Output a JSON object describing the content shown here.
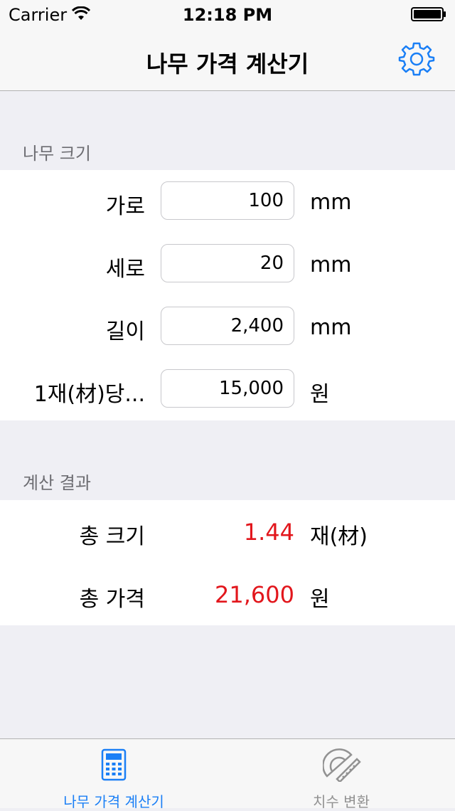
{
  "status": {
    "carrier": "Carrier",
    "time": "12:18 PM"
  },
  "nav": {
    "title": "나무 가격 계산기",
    "settings_icon": "gear-icon"
  },
  "size_section": {
    "header": "나무 크기",
    "rows": [
      {
        "label": "가로",
        "value": "100",
        "unit": "mm"
      },
      {
        "label": "세로",
        "value": "20",
        "unit": "mm"
      },
      {
        "label": "길이",
        "value": "2,400",
        "unit": "mm"
      },
      {
        "label": "1재(材)당...",
        "value": "15,000",
        "unit": "원"
      }
    ]
  },
  "result_section": {
    "header": "계산 결과",
    "rows": [
      {
        "label": "총 크기",
        "value": "1.44",
        "unit": "재(材)"
      },
      {
        "label": "총 가격",
        "value": "21,600",
        "unit": "원"
      }
    ]
  },
  "tabs": [
    {
      "label": "나무 가격 계산기",
      "icon": "calculator-icon",
      "selected": true
    },
    {
      "label": "치수 변환",
      "icon": "protractor-ruler-icon",
      "selected": false
    }
  ],
  "colors": {
    "accent": "#1a7ff6",
    "result": "#e2161c",
    "tab_inactive": "#929292"
  }
}
